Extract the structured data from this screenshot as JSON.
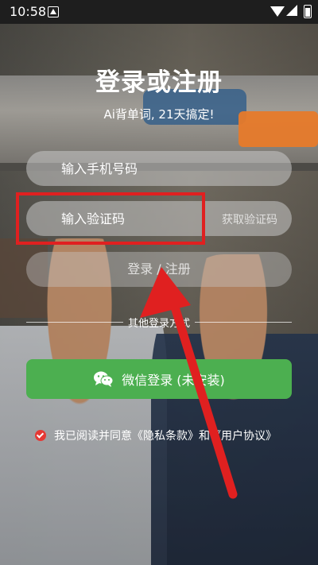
{
  "status_bar": {
    "time": "10:58"
  },
  "header": {
    "title": "登录或注册",
    "subtitle": "Ai背单词, 21天搞定!"
  },
  "form": {
    "phone_placeholder": "输入手机号码",
    "code_placeholder": "输入验证码",
    "get_code_label": "获取验证码",
    "login_label": "登录 / 注册"
  },
  "other_login": {
    "label": "其他登录方式"
  },
  "wechat": {
    "label": "微信登录 (未安装)"
  },
  "agreement": {
    "text": "我已阅读并同意《隐私条款》和《用户协议》"
  },
  "colors": {
    "accent_green": "#4caf50",
    "highlight_red": "#e02020"
  }
}
